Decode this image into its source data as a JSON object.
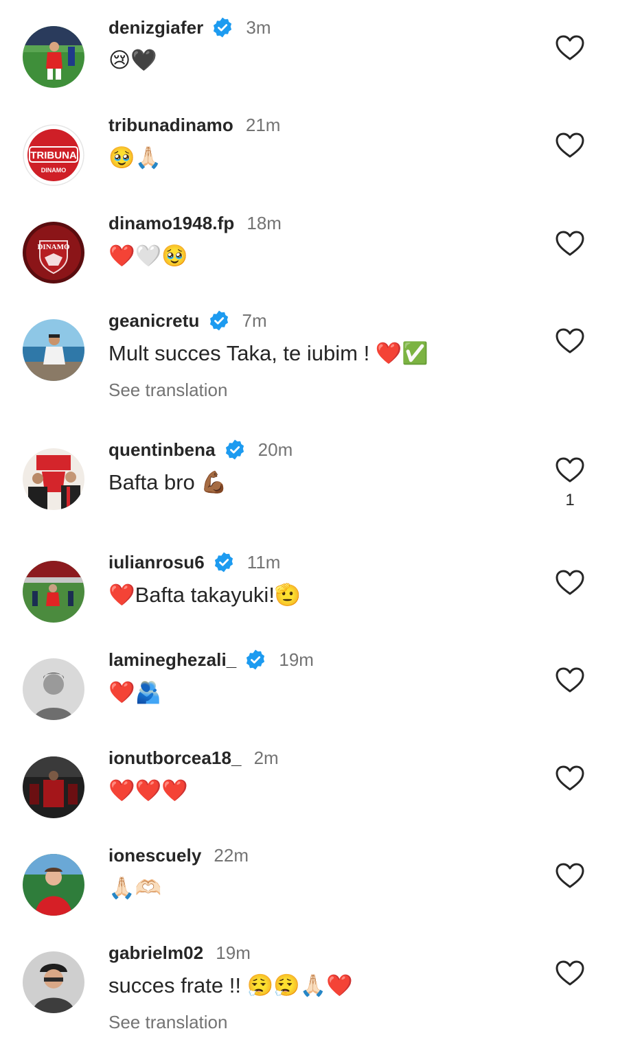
{
  "comments": [
    {
      "username": "denizgiafer",
      "verified": true,
      "time": "3m",
      "text": "😢🖤",
      "avatar": "soccer-player-avatar"
    },
    {
      "username": "tribunadinamo",
      "verified": false,
      "time": "21m",
      "text": "🥹🙏🏻",
      "avatar": "tribuna-logo-avatar",
      "avatar_text": "TRIBUNA",
      "avatar_subtext": "DINAMO"
    },
    {
      "username": "dinamo1948.fp",
      "verified": false,
      "time": "18m",
      "text": "❤️🤍🥹",
      "avatar": "dinamo-crest-avatar",
      "avatar_text": "DINAMO"
    },
    {
      "username": "geanicretu",
      "verified": true,
      "time": "7m",
      "text": "Mult succes Taka, te iubim ! ❤️✅",
      "translation": "See translation",
      "avatar": "beach-person-avatar"
    },
    {
      "username": "quentinbena",
      "verified": true,
      "time": "20m",
      "text": "Bafta bro 💪🏾",
      "likes": "1",
      "avatar": "two-people-avatar"
    },
    {
      "username": "iulianrosu6",
      "verified": true,
      "time": "11m",
      "text": "❤️Bafta takayuki!🫡",
      "avatar": "stadium-avatar"
    },
    {
      "username": "lamineghezali_",
      "verified": true,
      "time": "19m",
      "text": "❤️🫂",
      "avatar": "portrait-bw-avatar"
    },
    {
      "username": "ionutborcea18_",
      "verified": false,
      "time": "2m",
      "text": "❤️❤️❤️",
      "avatar": "dark-red-scene-avatar"
    },
    {
      "username": "ionescuely",
      "verified": false,
      "time": "22m",
      "text": "🙏🏻🫶🏻",
      "avatar": "red-jersey-avatar"
    },
    {
      "username": "gabrielm02",
      "verified": false,
      "time": "19m",
      "text": "succes frate !! 😮‍💨😮‍💨🙏🏻❤️",
      "translation": "See translation",
      "avatar": "selfie-avatar"
    }
  ],
  "colors": {
    "verified_blue": "#1d9bf0",
    "text_primary": "#262626",
    "text_secondary": "#737373",
    "heart_outline": "#262626"
  }
}
